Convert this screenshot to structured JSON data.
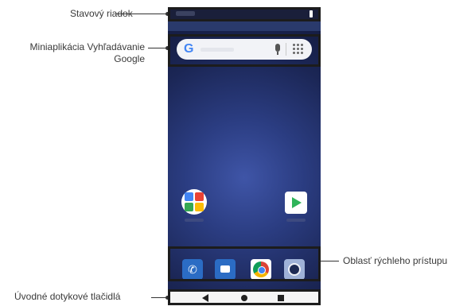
{
  "callouts": {
    "status_bar": "Stavový riadok",
    "google_widget": "Miniaplikácia Vyhľadávanie Google",
    "quick_access": "Oblasť rýchleho prístupu",
    "home_touch_buttons": "Úvodné dotykové tlačidlá"
  },
  "search_widget": {
    "logo": "G"
  },
  "dock": {
    "apps": [
      "phone-app",
      "messages-app",
      "chrome-app",
      "camera-app"
    ]
  },
  "navigation": {
    "buttons": [
      "back",
      "home",
      "recent-apps"
    ]
  }
}
